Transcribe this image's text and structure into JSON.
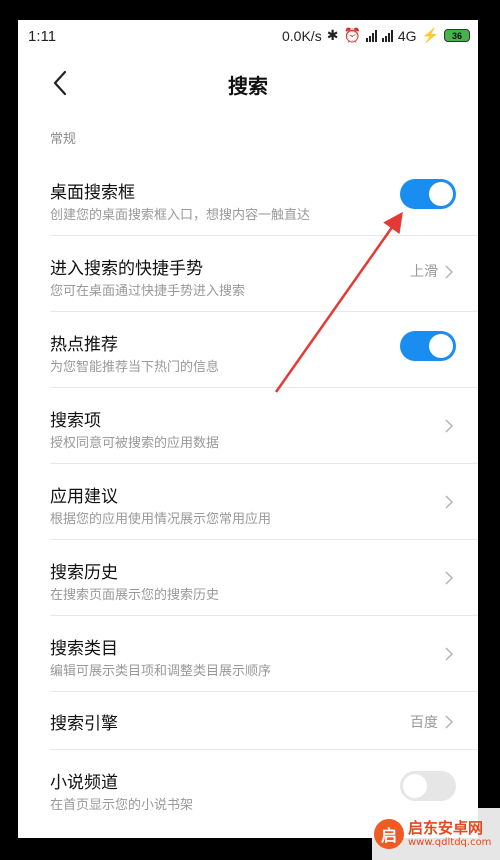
{
  "statusbar": {
    "time": "1:11",
    "speed": "0.0K/s",
    "network": "4G",
    "battery": "36"
  },
  "header": {
    "title": "搜索"
  },
  "section": {
    "label": "常规"
  },
  "settings": [
    {
      "title": "桌面搜索框",
      "subtitle": "创建您的桌面搜索框入口，想搜内容一触直达",
      "toggle": true
    },
    {
      "title": "进入搜索的快捷手势",
      "subtitle": "您可在桌面通过快捷手势进入搜索",
      "value": "上滑"
    },
    {
      "title": "热点推荐",
      "subtitle": "为您智能推荐当下热门的信息",
      "toggle": true
    },
    {
      "title": "搜索项",
      "subtitle": "授权同意可被搜索的应用数据"
    },
    {
      "title": "应用建议",
      "subtitle": "根据您的应用使用情况展示您常用应用"
    },
    {
      "title": "搜索历史",
      "subtitle": "在搜索页面展示您的搜索历史"
    },
    {
      "title": "搜索类目",
      "subtitle": "编辑可展示类目项和调整类目展示顺序"
    },
    {
      "title": "搜索引擎",
      "value": "百度"
    },
    {
      "title": "小说频道",
      "subtitle": "在首页显示您的小说书架",
      "toggle": false
    }
  ],
  "watermark": {
    "name": "启东安卓网",
    "url": "www.qdltdq.com"
  },
  "colors": {
    "accent": "#1a8ef0",
    "annotation_arrow": "#e53935"
  }
}
